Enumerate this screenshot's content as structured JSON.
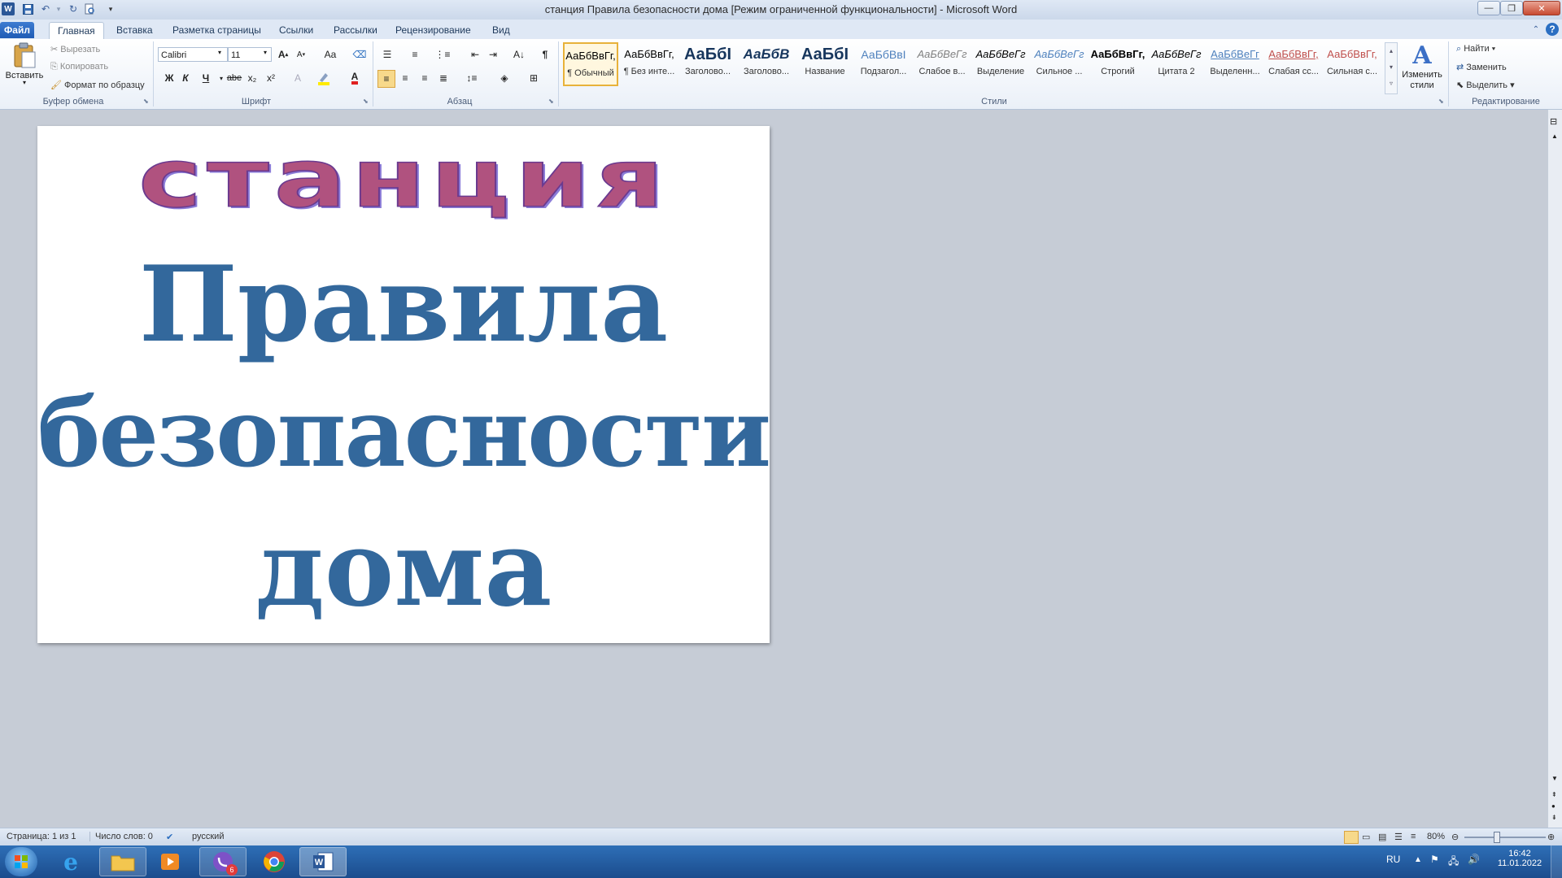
{
  "window": {
    "title": "станция Правила безопасности дома [Режим ограниченной функциональности]  -  Microsoft Word"
  },
  "qat": [
    "word-app-icon",
    "save-icon",
    "undo-icon",
    "redo-icon",
    "print-preview-icon",
    "customize-qat-icon"
  ],
  "tabs": {
    "file": "Файл",
    "items": [
      "Главная",
      "Вставка",
      "Разметка страницы",
      "Ссылки",
      "Рассылки",
      "Рецензирование",
      "Вид"
    ],
    "active": "Главная"
  },
  "clipboard": {
    "paste": "Вставить",
    "cut": "Вырезать",
    "copy": "Копировать",
    "format_painter": "Формат по образцу",
    "label": "Буфер обмена"
  },
  "font": {
    "name": "Calibri",
    "size": "11",
    "label": "Шрифт",
    "bold": "Ж",
    "italic": "К",
    "underline": "Ч",
    "strike": "abe",
    "subscript": "x₂",
    "superscript": "x²",
    "grow": "A",
    "shrink": "A",
    "case": "Aa"
  },
  "paragraph": {
    "label": "Абзац"
  },
  "styles": {
    "label": "Стили",
    "items": [
      {
        "sample": "АаБбВвГг,",
        "name": "¶ Обычный",
        "color": "#000000",
        "selected": true
      },
      {
        "sample": "АаБбВвГг,",
        "name": "¶ Без инте...",
        "color": "#000000"
      },
      {
        "sample": "АаБбI",
        "name": "Заголово...",
        "color": "#17365d"
      },
      {
        "sample": "АаБбВ",
        "name": "Заголово...",
        "color": "#17365d"
      },
      {
        "sample": "АаБбI",
        "name": "Название",
        "color": "#17365d"
      },
      {
        "sample": "АаБбВвI",
        "name": "Подзагол...",
        "color": "#4f81bd"
      },
      {
        "sample": "АаБбВеГг",
        "name": "Слабое в...",
        "color": "#808080"
      },
      {
        "sample": "АаБбВеГг",
        "name": "Выделение",
        "color": "#000000"
      },
      {
        "sample": "АаБбВеГг",
        "name": "Сильное ...",
        "color": "#4f81bd"
      },
      {
        "sample": "АаБбВвГг,",
        "name": "Строгий",
        "color": "#000000"
      },
      {
        "sample": "АаБбВеГг",
        "name": "Цитата 2",
        "color": "#000000"
      },
      {
        "sample": "АаБбВеГг",
        "name": "Выделенн...",
        "color": "#4f81bd"
      },
      {
        "sample": "АаБбВвГг,",
        "name": "Слабая сс...",
        "color": "#c0504d"
      },
      {
        "sample": "АаБбВвГг,",
        "name": "Сильная с...",
        "color": "#c0504d"
      }
    ],
    "change_styles": "Изменить стили"
  },
  "editing": {
    "label": "Редактирование",
    "find": "Найти",
    "replace": "Заменить",
    "select": "Выделить"
  },
  "document": {
    "wordart": "станция",
    "line1": "Правила",
    "line2": "безопасности",
    "line3": "дома",
    "wordart_fill": "#b0527f",
    "text_color": "#33689c"
  },
  "statusbar": {
    "page": "Страница: 1 из 1",
    "words": "Число слов: 0",
    "language": "русский",
    "zoom": "80%",
    "zoom_percent": 80
  },
  "taskbar": {
    "apps": [
      "start-orb-icon",
      "internet-explorer-icon",
      "file-explorer-icon",
      "media-player-icon",
      "viber-icon",
      "chrome-icon",
      "word-taskbar-icon"
    ],
    "viber_badge": "6",
    "lang": "RU",
    "time": "16:42",
    "date": "11.01.2022"
  }
}
